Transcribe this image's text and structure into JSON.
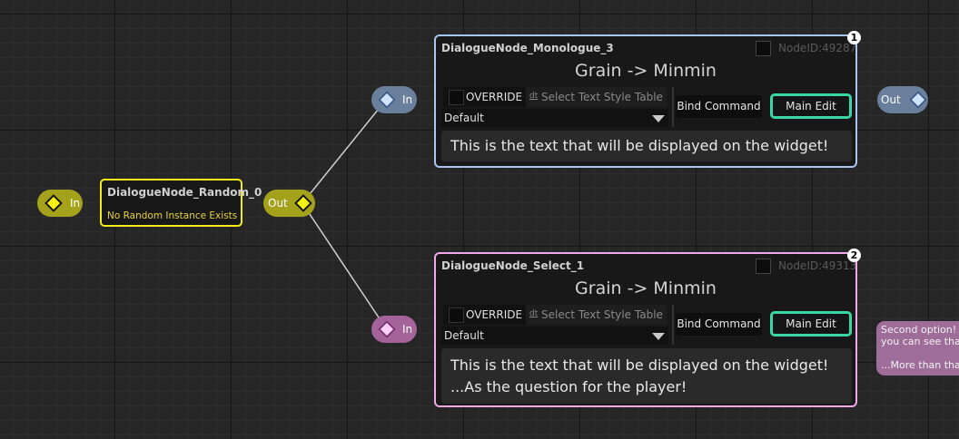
{
  "random_node": {
    "in_pin": "In",
    "title": "DialogueNode_Random_0",
    "subtitle": "No Random Instance Exists",
    "out_pin": "Out"
  },
  "nodes": [
    {
      "in_pin": "In",
      "title": "DialogueNode_Monologue_3",
      "node_id": "NodeID:49287",
      "badge": "1",
      "heading": "Grain -> Minmin",
      "override_label": "OVERRIDE",
      "style_icon": "dt",
      "style_placeholder": "Select Text Style Table",
      "combo_value": "Default",
      "bind_label": "Bind Command",
      "main_edit_label": "Main Edit",
      "text_lines": [
        "This is the text that will be displayed on the widget!"
      ],
      "out_pin": "Out"
    },
    {
      "in_pin": "In",
      "title": "DialogueNode_Select_1",
      "node_id": "NodeID:49313",
      "badge": "2",
      "heading": "Grain -> Minmin",
      "override_label": "OVERRIDE",
      "style_icon": "dt",
      "style_placeholder": "Select Text Style Table",
      "combo_value": "Default",
      "bind_label": "Bind Command",
      "main_edit_label": "Main Edit",
      "text_lines": [
        "This is the text that will be displayed on the widget!",
        "...As the question for the player!"
      ]
    }
  ],
  "option_bubble": {
    "lines": [
      "Second option!",
      "you can see tha",
      "",
      "...More than tha"
    ]
  },
  "colors": {
    "random_border": "#f3ee1a",
    "monologue_border": "#a8c7f0",
    "select_border": "#f0a8e8",
    "main_edit_border": "#3ad6a6"
  }
}
